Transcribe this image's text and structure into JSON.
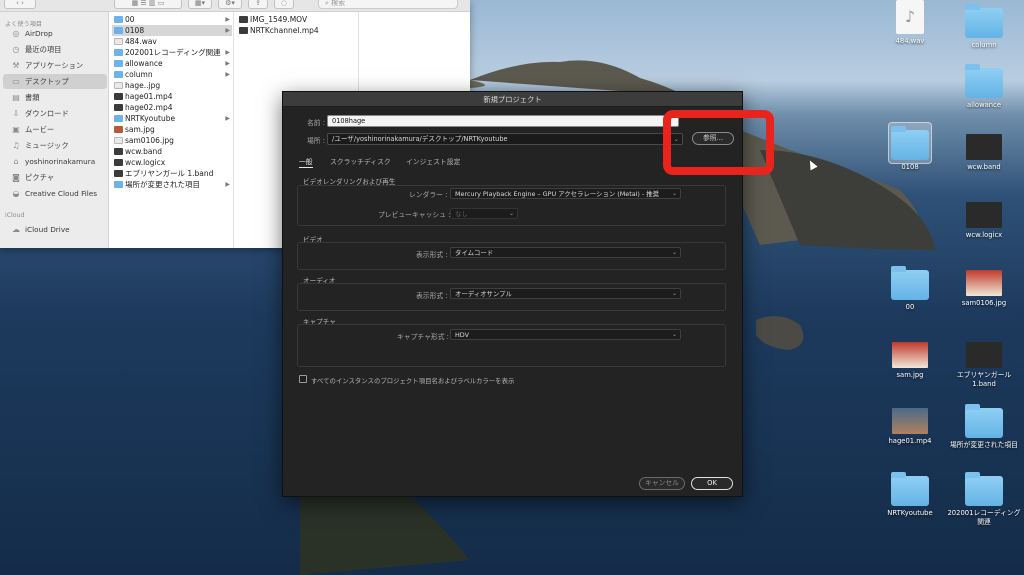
{
  "finder": {
    "toolbar": {
      "search_placeholder": "検索"
    },
    "sidebar": {
      "favorites_header": "よく使う項目",
      "items": [
        {
          "label": "AirDrop",
          "icon": "airdrop-icon"
        },
        {
          "label": "最近の項目",
          "icon": "clock-icon"
        },
        {
          "label": "アプリケーション",
          "icon": "applications-icon"
        },
        {
          "label": "デスクトップ",
          "icon": "desktop-icon",
          "selected": true
        },
        {
          "label": "書類",
          "icon": "document-icon"
        },
        {
          "label": "ダウンロード",
          "icon": "download-icon"
        },
        {
          "label": "ムービー",
          "icon": "movie-icon"
        },
        {
          "label": "ミュージック",
          "icon": "music-icon"
        },
        {
          "label": "yoshinorinakamura",
          "icon": "home-icon"
        },
        {
          "label": "ピクチャ",
          "icon": "camera-icon"
        },
        {
          "label": "Creative Cloud Files",
          "icon": "creative-cloud-icon"
        }
      ],
      "icloud_header": "iCloud",
      "icloud_items": [
        {
          "label": "iCloud Drive",
          "icon": "cloud-icon"
        }
      ]
    },
    "column1": [
      {
        "name": "00",
        "kind": "folder",
        "arrow": true
      },
      {
        "name": "0108",
        "kind": "folder",
        "arrow": true,
        "selected": true
      },
      {
        "name": "484.wav",
        "kind": "file"
      },
      {
        "name": "202001レコーディング関連",
        "kind": "folder",
        "arrow": true
      },
      {
        "name": "allowance",
        "kind": "folder",
        "arrow": true
      },
      {
        "name": "column",
        "kind": "folder",
        "arrow": true
      },
      {
        "name": "hage..jpg",
        "kind": "file"
      },
      {
        "name": "hage01.mp4",
        "kind": "dark"
      },
      {
        "name": "hage02.mp4",
        "kind": "dark"
      },
      {
        "name": "NRTKyoutube",
        "kind": "folder",
        "arrow": true
      },
      {
        "name": "sam.jpg",
        "kind": "img"
      },
      {
        "name": "sam0106.jpg",
        "kind": "file"
      },
      {
        "name": "wcw.band",
        "kind": "dark"
      },
      {
        "name": "wcw.logicx",
        "kind": "dark"
      },
      {
        "name": "エブリヤンガール 1.band",
        "kind": "dark"
      },
      {
        "name": "場所が変更された項目",
        "kind": "folder",
        "arrow": true
      }
    ],
    "column2": [
      {
        "name": "IMG_1549.MOV",
        "kind": "dark"
      },
      {
        "name": "NRTKchannel.mp4",
        "kind": "dark"
      }
    ]
  },
  "dialog": {
    "title": "新規プロジェクト",
    "name_label": "名前 :",
    "name_value": "0108hage",
    "location_label": "場所 :",
    "location_value": "/ユーザ/yoshinorinakamura/デスクトップ/NRTKyoutube",
    "browse_button": "参照...",
    "tabs": [
      {
        "label": "一般",
        "active": true
      },
      {
        "label": "スクラッチディスク"
      },
      {
        "label": "インジェスト設定"
      }
    ],
    "sections": {
      "render": {
        "title": "ビデオレンダリングおよび再生",
        "renderer_label": "レンダラー :",
        "renderer_value": "Mercury Playback Engine – GPU アクセラレーション (Metal) - 推奨",
        "preview_cache_label": "プレビューキャッシュ :",
        "preview_cache_value": "なし"
      },
      "video": {
        "title": "ビデオ",
        "display_label": "表示形式 :",
        "display_value": "タイムコード"
      },
      "audio": {
        "title": "オーディオ",
        "display_label": "表示形式 :",
        "display_value": "オーディオサンプル"
      },
      "capture": {
        "title": "キャプチャ",
        "format_label": "キャプチャ形式 :",
        "format_value": "HDV"
      }
    },
    "checkbox_label": "すべてのインスタンスのプロジェクト項目名およびラベルカラーを表示",
    "cancel_button": "キャンセル",
    "ok_button": "OK"
  },
  "desktop": {
    "icons": [
      {
        "label": "484.wav"
      },
      {
        "label": "column"
      },
      {
        "label": "allowance"
      },
      {
        "label": "0108"
      },
      {
        "label": "wcw.band"
      },
      {
        "label": "wcw.logicx"
      },
      {
        "label": "00"
      },
      {
        "label": "sam0106.jpg"
      },
      {
        "label": "sam.jpg"
      },
      {
        "label": "エブリヤンガール 1.band"
      },
      {
        "label": "hage01.mp4"
      },
      {
        "label": "場所が変更された項目"
      },
      {
        "label": "NRTKyoutube"
      },
      {
        "label": "202001レコーディング関連"
      }
    ]
  },
  "colors": {
    "annotation": "#e8241c",
    "folder": "#64b3e6",
    "dialog_bg": "#232323"
  }
}
